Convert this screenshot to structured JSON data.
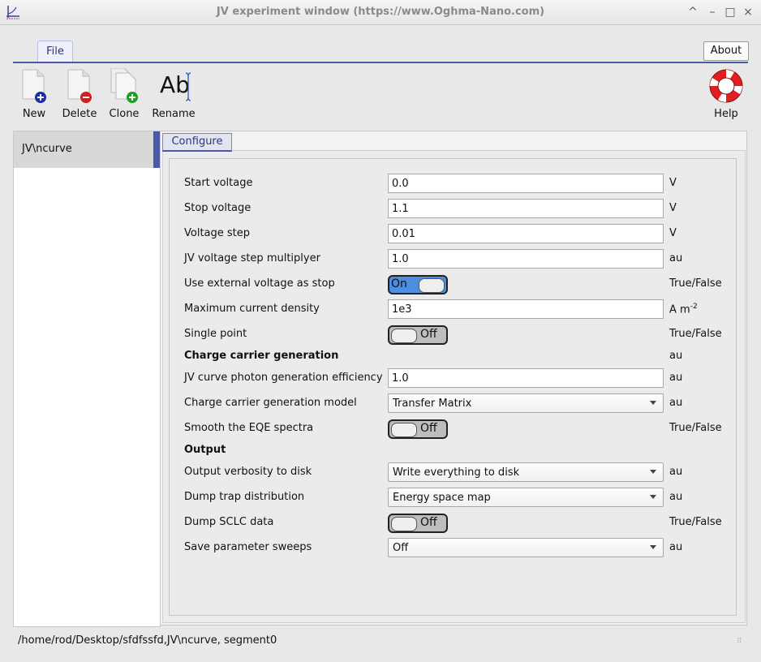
{
  "window": {
    "title": "JV experiment window (https://www.Oghma-Nano.com)",
    "controls": [
      "^",
      "–",
      "□",
      "×"
    ]
  },
  "ribbon": {
    "file_tab": "File",
    "about_button": "About"
  },
  "toolbar": {
    "new": "New",
    "delete": "Delete",
    "clone": "Clone",
    "rename": "Rename",
    "rename_icon_text": "Ab",
    "help": "Help"
  },
  "sidebar": {
    "items": [
      {
        "label": "JV\\ncurve"
      }
    ]
  },
  "main": {
    "tab": "Configure",
    "rows": {
      "start_voltage": {
        "label": "Start voltage",
        "value": "0.0",
        "unit": "V"
      },
      "stop_voltage": {
        "label": "Stop voltage",
        "value": "1.1",
        "unit": "V"
      },
      "voltage_step": {
        "label": "Voltage step",
        "value": "0.01",
        "unit": "V"
      },
      "step_multiplyer": {
        "label": "JV voltage step multiplyer",
        "value": "1.0",
        "unit": "au"
      },
      "external_voltage": {
        "label": "Use external voltage as stop",
        "value": "On",
        "unit": "True/False"
      },
      "max_current": {
        "label": "Maximum current density",
        "value": "1e3",
        "unit": "A m",
        "unit_sup": "-2"
      },
      "single_point": {
        "label": "Single point",
        "value": "Off",
        "unit": "True/False"
      },
      "gen_header": {
        "label": "Charge carrier generation",
        "unit": "au"
      },
      "photon_eff": {
        "label": "JV curve photon generation efficiency",
        "value": "1.0",
        "unit": "au"
      },
      "gen_model": {
        "label": "Charge carrier generation model",
        "value": "Transfer Matrix",
        "unit": "au"
      },
      "smooth_eqe": {
        "label": "Smooth the EQE spectra",
        "value": "Off",
        "unit": "True/False"
      },
      "output_header": {
        "label": "Output"
      },
      "verbosity": {
        "label": "Output verbosity to disk",
        "value": "Write everything to disk",
        "unit": "au"
      },
      "trap_dist": {
        "label": "Dump trap distribution",
        "value": "Energy space map",
        "unit": "au"
      },
      "sclc": {
        "label": "Dump SCLC data",
        "value": "Off",
        "unit": "True/False"
      },
      "sweeps": {
        "label": "Save parameter sweeps",
        "value": "Off",
        "unit": "au"
      }
    }
  },
  "status": {
    "path": "/home/rod/Desktop/sfdfssfd,JV\\ncurve, segment0"
  },
  "colors": {
    "accent": "#4a5aa8",
    "toggle_on": "#4d8ee0"
  }
}
